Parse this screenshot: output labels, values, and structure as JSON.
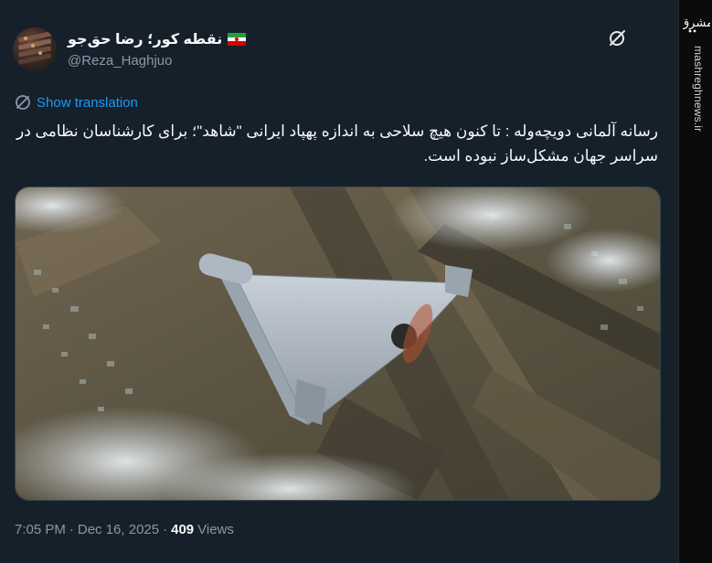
{
  "author": {
    "display_name": "نقطه کور؛ رضا حق‌جو",
    "flag_icon": "iran-flag-icon",
    "handle": "@Reza_Haghjuo"
  },
  "grok_icon": "grok-icon",
  "translation": {
    "label": "Show translation",
    "icon": "translate-globe-icon"
  },
  "tweet_text": "رسانه آلمانی دویچه‌وله : تا کنون هیچ سلاحی به اندازه پهپاد ایرانی \"شاهد\"؛ برای کارشناسان نظامی در سراسر جهان مشکل‌ساز نبوده است.",
  "media": {
    "description_icon": "shahed-drone-photo"
  },
  "meta": {
    "time": "7:05 PM",
    "separator": "·",
    "date": "Dec 16, 2025",
    "views_count": "409",
    "views_label": "Views"
  },
  "watermark": {
    "logo_text": "مشرق",
    "site": "mashreghnews.ir"
  },
  "colors": {
    "background": "#15202b",
    "text": "#f7f9f9",
    "secondary": "#8b98a5",
    "link": "#1d9bf0"
  }
}
